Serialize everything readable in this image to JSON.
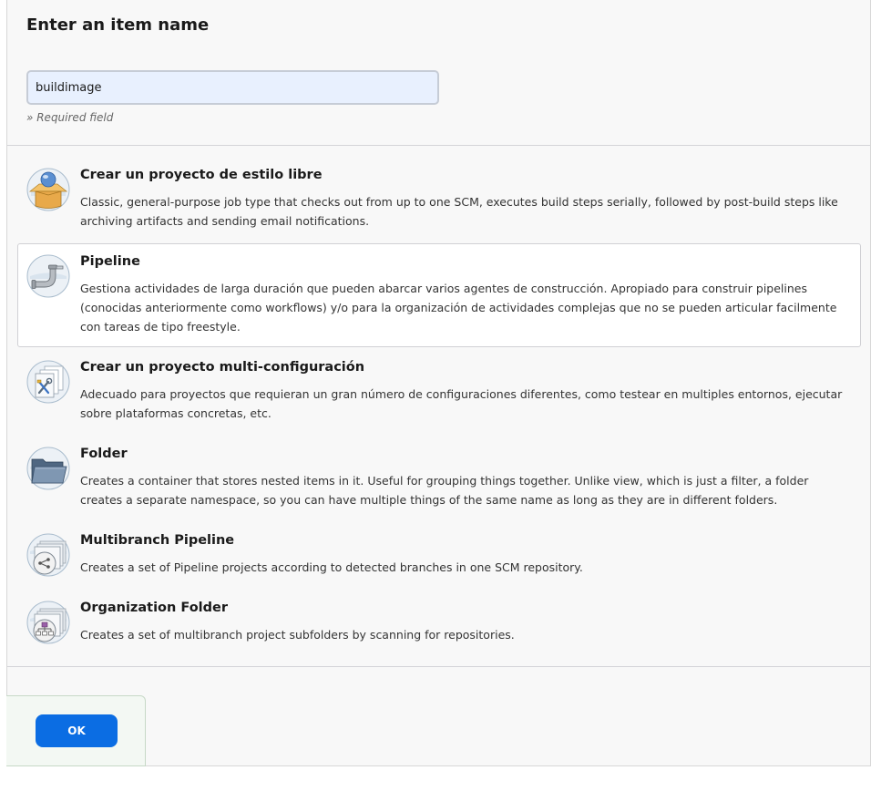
{
  "header": {
    "title": "Enter an item name",
    "input_value": "buildimage",
    "hint": "» Required field"
  },
  "items": [
    {
      "name": "Crear un proyecto de estilo libre",
      "desc": "Classic, general-purpose job type that checks out from up to one SCM, executes build steps serially, followed by post-build steps like archiving artifacts and sending email notifications.",
      "icon": "freestyle-box-icon"
    },
    {
      "name": "Pipeline",
      "desc": "Gestiona actividades de larga duración que pueden abarcar varios agentes de construcción. Apropiado para construir pipelines (conocidas anteriormente como workflows) y/o para la organización de actividades complejas que no se pueden articular facilmente con tareas de tipo freestyle.",
      "icon": "pipe-icon"
    },
    {
      "name": "Crear un proyecto multi-configuración",
      "desc": "Adecuado para proyectos que requieran un gran número de configuraciones diferentes, como testear en multiples entornos, ejecutar sobre plataformas concretas, etc.",
      "icon": "multi-config-icon"
    },
    {
      "name": "Folder",
      "desc": "Creates a container that stores nested items in it. Useful for grouping things together. Unlike view, which is just a filter, a folder creates a separate namespace, so you can have multiple things of the same name as long as they are in different folders.",
      "icon": "folder-icon"
    },
    {
      "name": "Multibranch Pipeline",
      "desc": "Creates a set of Pipeline projects according to detected branches in one SCM repository.",
      "icon": "multibranch-icon"
    },
    {
      "name": "Organization Folder",
      "desc": "Creates a set of multibranch project subfolders by scanning for repositories.",
      "icon": "organization-folder-icon"
    }
  ],
  "footer": {
    "ok_label": "OK"
  },
  "colors": {
    "accent": "#0b6de3",
    "input_bg": "#e8f0fe",
    "panel_bg": "#f8f8f8"
  }
}
